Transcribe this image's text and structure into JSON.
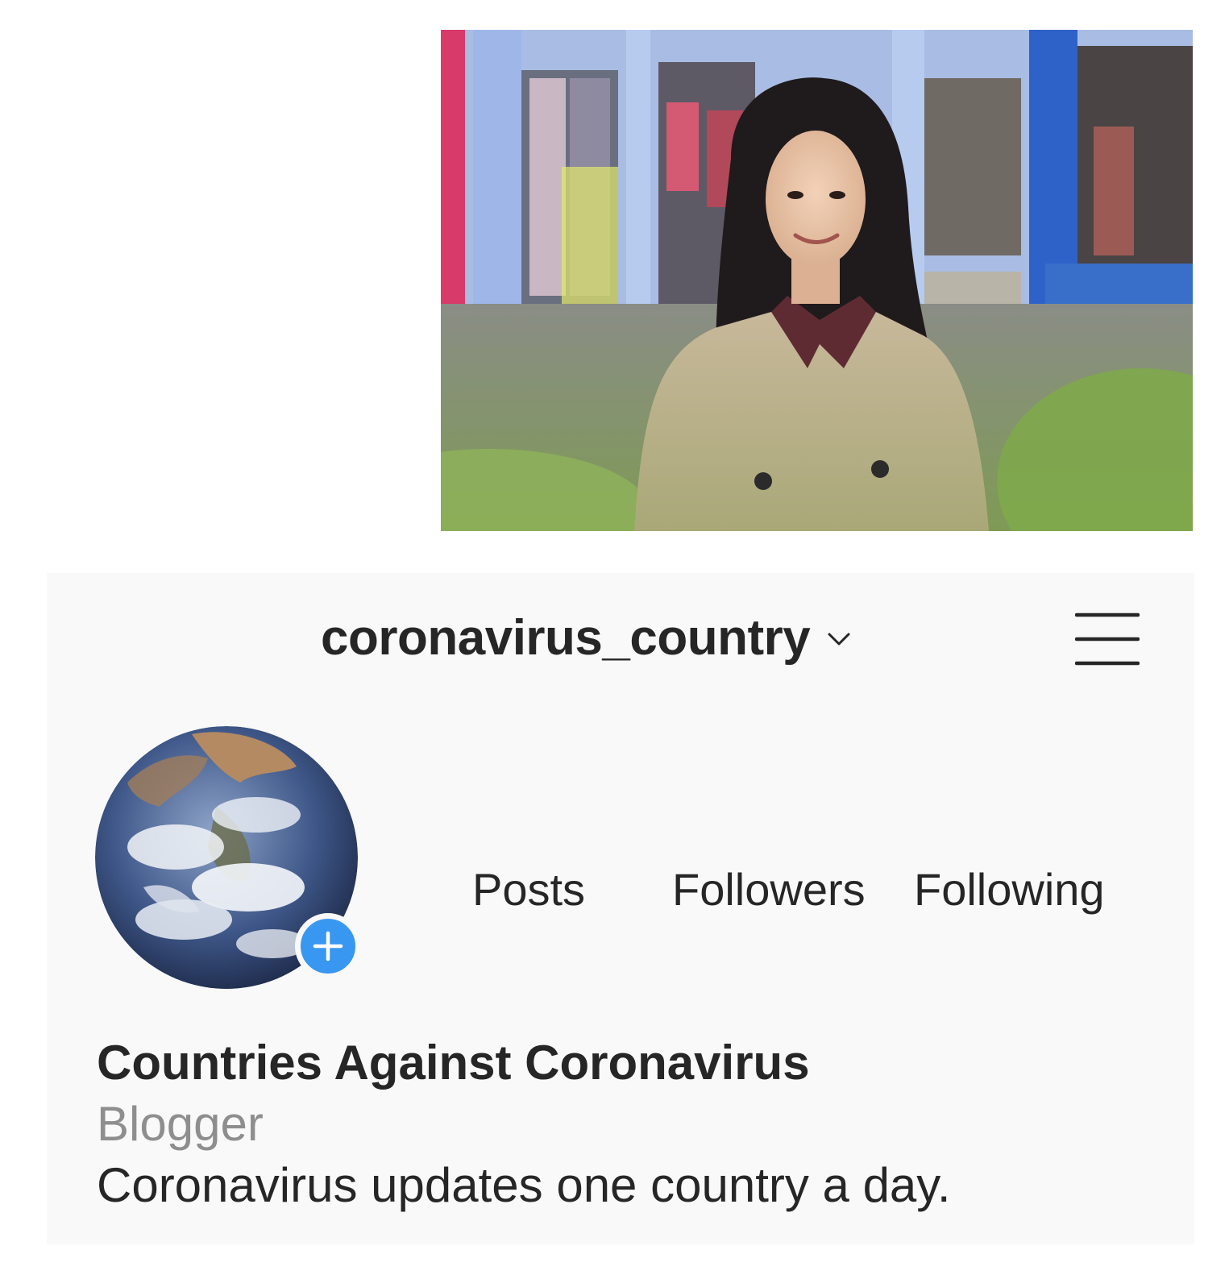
{
  "profile": {
    "username": "coronavirus_country",
    "display_name": "Countries Against Coronavirus",
    "category": "Blogger",
    "bio": "Coronavirus updates one country a day."
  },
  "stats": {
    "posts_label": "Posts",
    "followers_label": "Followers",
    "following_label": "Following"
  },
  "icons": {
    "username_dropdown": "chevron-down-icon",
    "menu": "hamburger-menu-icon",
    "add_story": "plus-icon"
  },
  "colors": {
    "card_background": "#f9f9f9",
    "text_primary": "#262626",
    "text_secondary": "#8e8e8e",
    "add_button": "#3897f0"
  }
}
